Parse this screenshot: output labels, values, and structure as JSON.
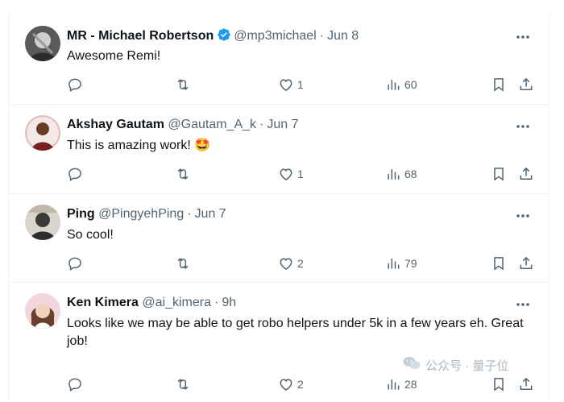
{
  "replies": [
    {
      "name": "MR - Michael Robertson",
      "verified": true,
      "handle": "@mp3michael",
      "sep": "·",
      "date": "Jun 8",
      "text": "Awesome Remi!",
      "likes": "1",
      "views": "60"
    },
    {
      "name": "Akshay Gautam",
      "verified": false,
      "handle": "@Gautam_A_k",
      "sep": "·",
      "date": "Jun 7",
      "text": "This is amazing work! 🤩",
      "likes": "1",
      "views": "68"
    },
    {
      "name": "Ping",
      "verified": false,
      "handle": "@PingyehPing",
      "sep": "·",
      "date": "Jun 7",
      "text": "So cool!",
      "likes": "2",
      "views": "79"
    },
    {
      "name": "Ken Kimera",
      "verified": false,
      "handle": "@ai_kimera",
      "sep": "·",
      "date": "9h",
      "text": "Looks like we may be able to get robo helpers under 5k in a few years eh. Great job!",
      "likes": "2",
      "views": "28"
    }
  ],
  "watermark": {
    "text": "公众号 · 量子位"
  },
  "colors": {
    "text_primary": "#0f1419",
    "text_secondary": "#536471",
    "verified_blue": "#1d9bf0",
    "divider": "#eff3f4"
  },
  "icons": [
    "reply-icon",
    "retweet-icon",
    "like-icon",
    "views-icon",
    "bookmark-icon",
    "share-icon",
    "more-icon",
    "verified-icon",
    "wechat-icon"
  ]
}
